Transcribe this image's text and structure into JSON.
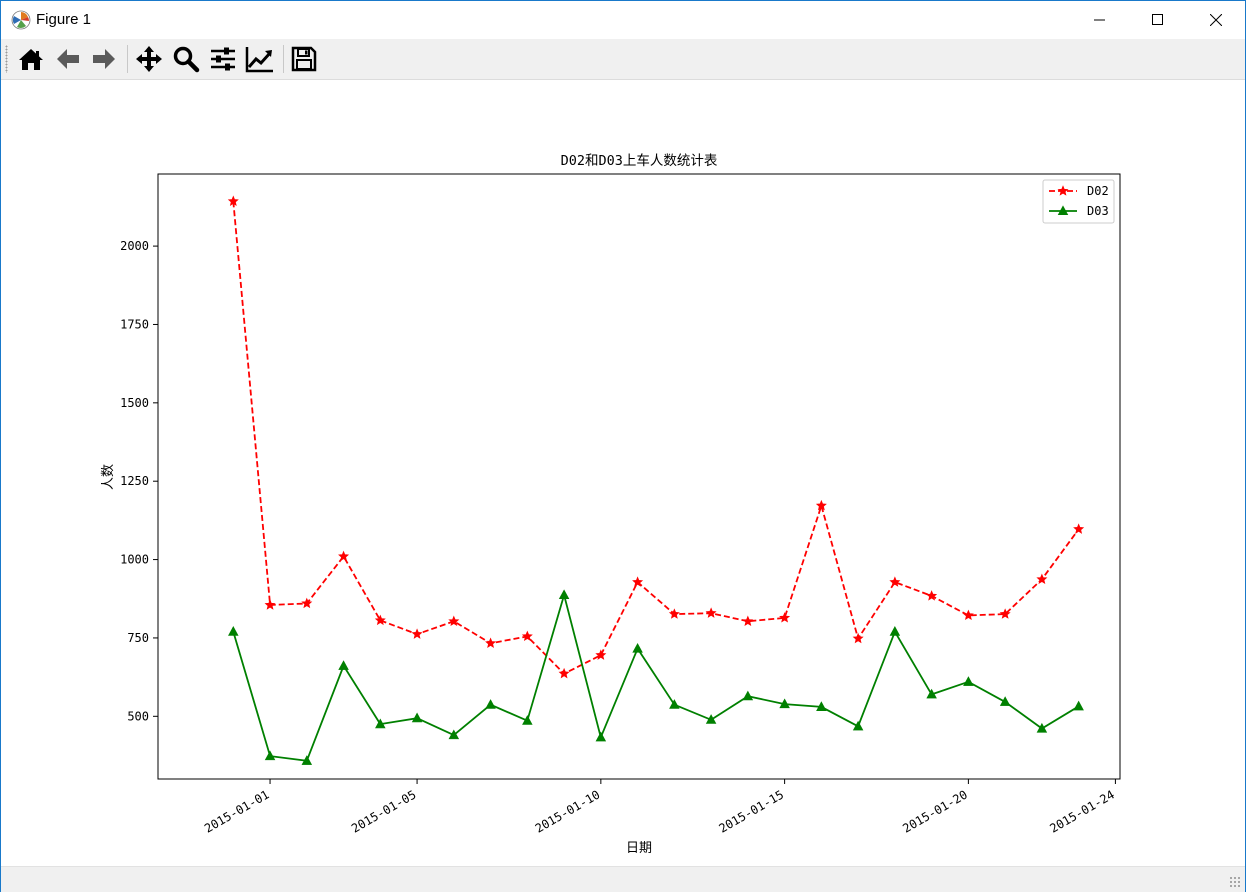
{
  "window": {
    "title": "Figure 1"
  },
  "toolbar": {
    "items": [
      {
        "name": "home-icon"
      },
      {
        "name": "back-arrow-icon"
      },
      {
        "name": "forward-arrow-icon"
      },
      {
        "name": "pan-move-icon"
      },
      {
        "name": "zoom-magnifier-icon"
      },
      {
        "name": "configure-subplots-icon"
      },
      {
        "name": "edit-axis-curves-icon"
      },
      {
        "name": "save-floppy-icon"
      }
    ]
  },
  "chart_data": {
    "type": "line",
    "title": "D02和D03上车人数统计表",
    "xlabel": "日期",
    "ylabel": "人数",
    "x_tick_labels": [
      "2015-01-01",
      "2015-01-05",
      "2015-01-10",
      "2015-01-15",
      "2015-01-20",
      "2015-01-24"
    ],
    "y_tick_labels": [
      "500",
      "750",
      "1000",
      "1250",
      "1500",
      "1750",
      "2000"
    ],
    "ylim": [
      300,
      2230
    ],
    "x": [
      "2014-12-31",
      "2015-01-01",
      "2015-01-02",
      "2015-01-03",
      "2015-01-04",
      "2015-01-05",
      "2015-01-06",
      "2015-01-07",
      "2015-01-08",
      "2015-01-09",
      "2015-01-10",
      "2015-01-11",
      "2015-01-12",
      "2015-01-13",
      "2015-01-14",
      "2015-01-15",
      "2015-01-16",
      "2015-01-17",
      "2015-01-18",
      "2015-01-19",
      "2015-01-20",
      "2015-01-21",
      "2015-01-22",
      "2015-01-23"
    ],
    "series": [
      {
        "name": "D02",
        "color": "#ff0000",
        "linestyle": "dashed",
        "marker": "star",
        "values": [
          2143,
          855,
          860,
          1010,
          806,
          762,
          803,
          733,
          755,
          636,
          695,
          928,
          826,
          829,
          803,
          814,
          1172,
          748,
          928,
          884,
          822,
          826,
          937,
          1097
        ]
      },
      {
        "name": "D03",
        "color": "#008000",
        "linestyle": "solid",
        "marker": "triangle",
        "values": [
          770,
          373,
          358,
          661,
          475,
          494,
          440,
          537,
          486,
          887,
          433,
          716,
          537,
          489,
          564,
          539,
          530,
          468,
          770,
          570,
          610,
          546,
          461,
          532
        ]
      }
    ],
    "legend": "top-right",
    "grid": false
  }
}
